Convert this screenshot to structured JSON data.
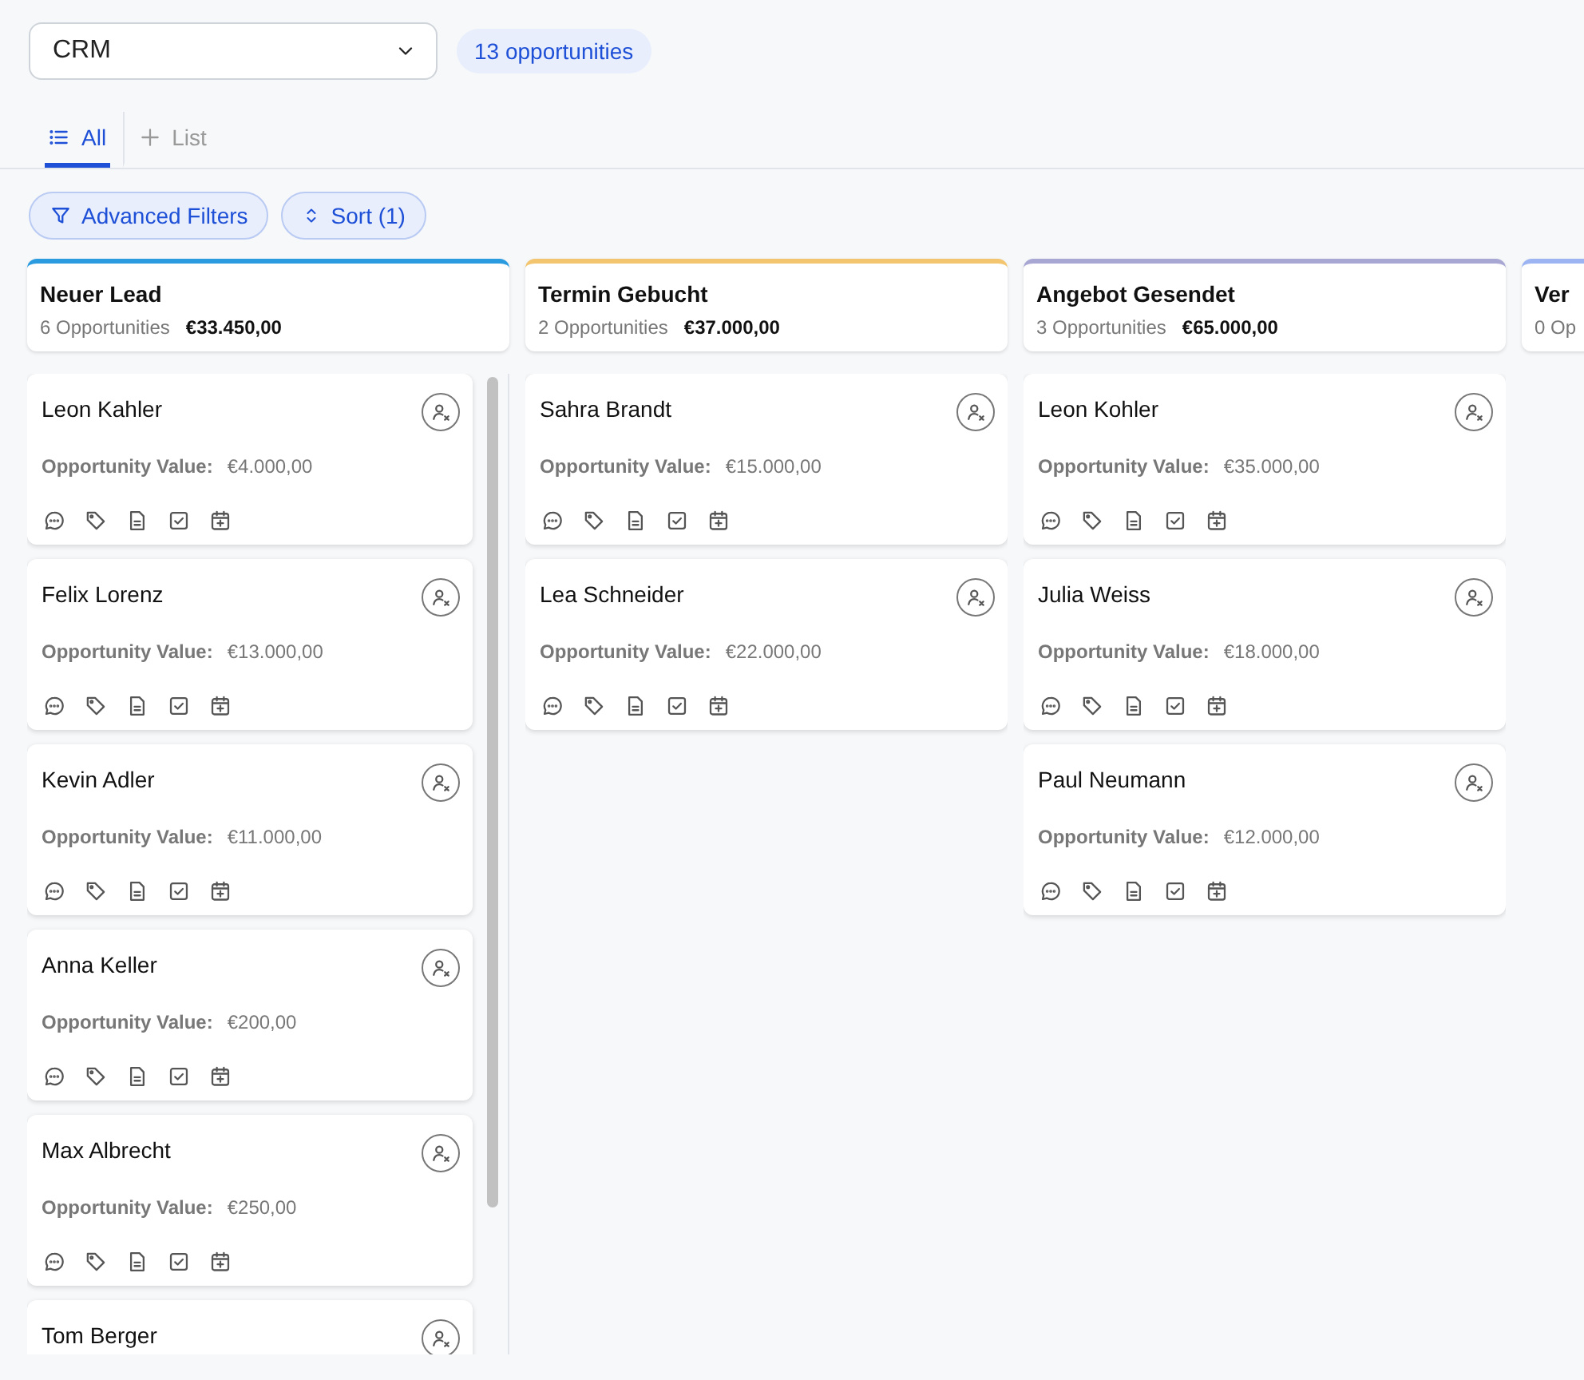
{
  "pipeline_select": {
    "value": "CRM"
  },
  "count_badge": "13 opportunities",
  "tabs": [
    {
      "label": "All",
      "kind": "list",
      "selected": true
    },
    {
      "label": "List",
      "kind": "add",
      "selected": false
    }
  ],
  "filters": [
    {
      "label": "Advanced Filters",
      "kind": "filter"
    },
    {
      "label": "Sort (1)",
      "kind": "sort"
    }
  ],
  "columns": [
    {
      "title": "Neuer Lead",
      "count": "6 Opportunities",
      "total": "€33.450,00",
      "color": "#2b9be0",
      "scrollable": true,
      "cards": [
        {
          "name": "Leon Kahler",
          "value_label": "Opportunity Value:",
          "value": "€4.000,00"
        },
        {
          "name": "Felix Lorenz",
          "value_label": "Opportunity Value:",
          "value": "€13.000,00"
        },
        {
          "name": "Kevin Adler",
          "value_label": "Opportunity Value:",
          "value": "€11.000,00"
        },
        {
          "name": "Anna Keller",
          "value_label": "Opportunity Value:",
          "value": "€200,00"
        },
        {
          "name": "Max Albrecht",
          "value_label": "Opportunity Value:",
          "value": "€250,00"
        },
        {
          "name": "Tom Berger"
        }
      ]
    },
    {
      "title": "Termin Gebucht",
      "count": "2 Opportunities",
      "total": "€37.000,00",
      "color": "#f2c56e",
      "cards": [
        {
          "name": "Sahra Brandt",
          "value_label": "Opportunity Value:",
          "value": "€15.000,00"
        },
        {
          "name": "Lea Schneider",
          "value_label": "Opportunity Value:",
          "value": "€22.000,00"
        }
      ]
    },
    {
      "title": "Angebot Gesendet",
      "count": "3 Opportunities",
      "total": "€65.000,00",
      "color": "#a8a7d4",
      "cards": [
        {
          "name": "Leon Kohler",
          "value_label": "Opportunity Value:",
          "value": "€35.000,00"
        },
        {
          "name": "Julia Weiss",
          "value_label": "Opportunity Value:",
          "value": "€18.000,00"
        },
        {
          "name": "Paul Neumann",
          "value_label": "Opportunity Value:",
          "value": "€12.000,00"
        }
      ]
    },
    {
      "title": "Ver",
      "count": "0 Op",
      "color": "#9cb4f2"
    }
  ]
}
